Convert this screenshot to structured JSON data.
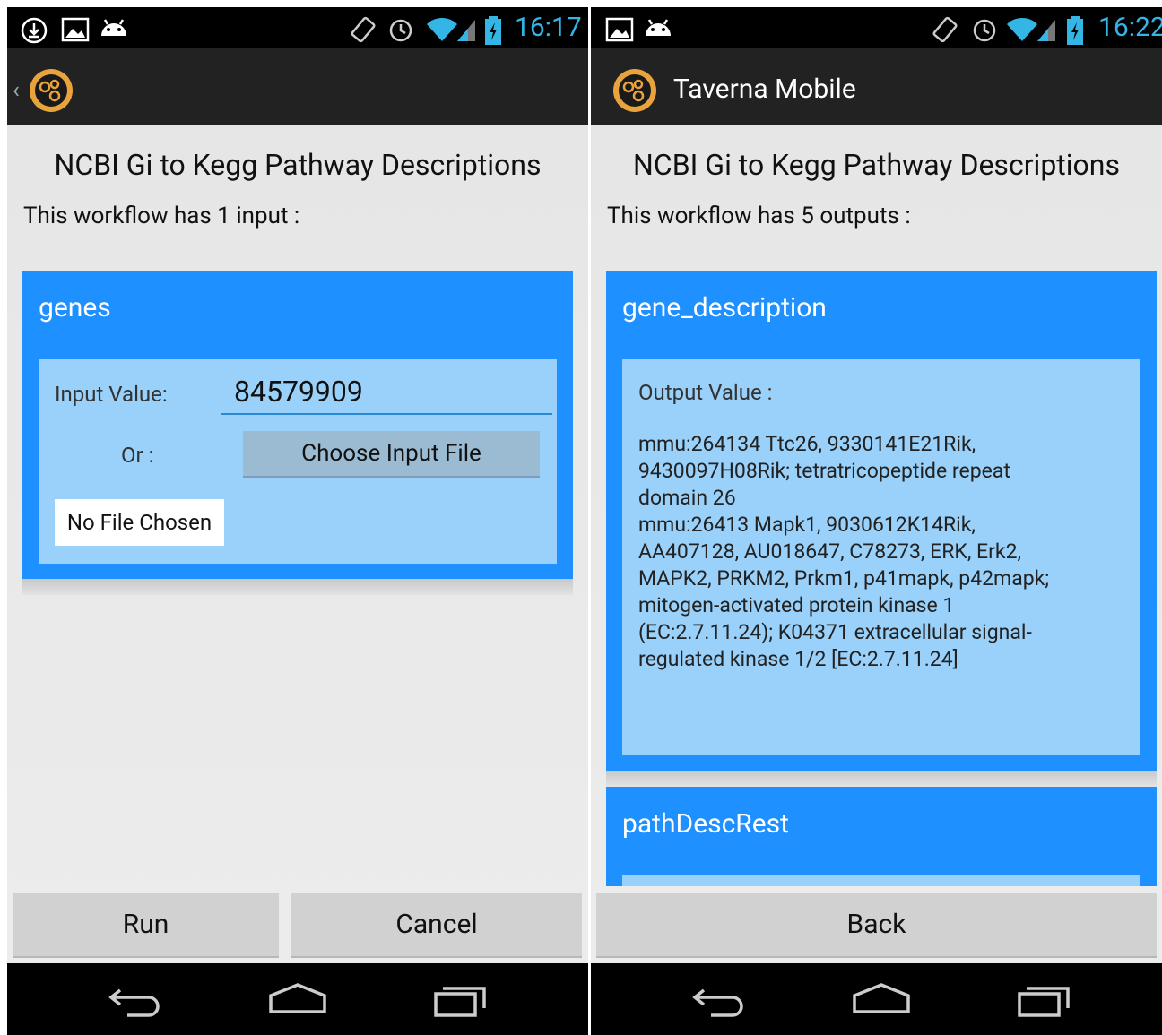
{
  "left": {
    "status": {
      "time": "16:17"
    },
    "workflow_title": "NCBI Gi to Kegg Pathway Descriptions",
    "count_text": "This workflow has 1 input :",
    "input": {
      "name": "genes",
      "value_label": "Input Value:",
      "value": "84579909",
      "or_label": "Or :",
      "choose_file_label": "Choose Input File",
      "file_status": "No File Chosen"
    },
    "buttons": {
      "run": "Run",
      "cancel": "Cancel"
    }
  },
  "right": {
    "status": {
      "time": "16:22"
    },
    "app_title": "Taverna Mobile",
    "workflow_title": "NCBI Gi to Kegg Pathway Descriptions",
    "count_text": "This workflow has 5 outputs :",
    "outputs": [
      {
        "name": "gene_description",
        "value_label": "Output Value :",
        "lines": [
          "mmu:264134  Ttc26, 9330141E21Rik,",
          "9430097H08Rik; tetratricopeptide repeat",
          "domain 26",
          "mmu:26413 Mapk1, 9030612K14Rik,",
          "AA407128, AU018647, C78273, ERK, Erk2,",
          "MAPK2, PRKM2, Prkm1, p41mapk, p42mapk;",
          "mitogen-activated protein kinase 1",
          "(EC:2.7.11.24); K04371 extracellular signal-",
          "regulated kinase 1/2 [EC:2.7.11.24]"
        ]
      },
      {
        "name": "pathDescRest"
      }
    ],
    "buttons": {
      "back": "Back"
    }
  },
  "colors": {
    "card": "#1e90ff",
    "card_inner": "#99d1fa",
    "action_bar": "#222222",
    "status_clock": "#33b5e5",
    "button": "#d1d1d1"
  },
  "icons": {
    "status_left": [
      "download-icon",
      "image-icon",
      "android-icon",
      "rotation-icon",
      "alarm-icon",
      "wifi-icon",
      "signal-icon",
      "battery-charging-icon"
    ],
    "status_right": [
      "image-icon",
      "android-icon",
      "rotation-icon",
      "alarm-icon",
      "wifi-icon",
      "signal-icon",
      "battery-charging-icon"
    ],
    "nav": [
      "back-nav-icon",
      "home-nav-icon",
      "recents-nav-icon"
    ]
  }
}
